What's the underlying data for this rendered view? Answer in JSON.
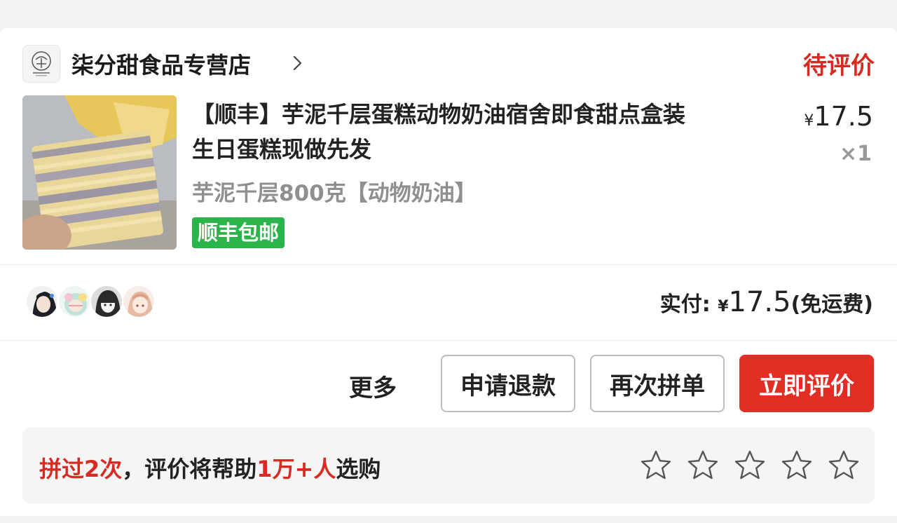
{
  "store": {
    "name": "柒分甜食品专营店",
    "status": "待评价"
  },
  "product": {
    "title_line1": "【顺丰】芋泥千层蛋糕动物奶油宿舍即食甜点盒装",
    "title_line2": "生日蛋糕现做先发",
    "price_symbol": "¥",
    "price": "17.5",
    "quantity": "×1",
    "spec": "芋泥千层800克【动物奶油】",
    "shipping_tag": "顺丰包邮"
  },
  "payment": {
    "label": "实付:",
    "symbol": "¥",
    "amount": "17.5",
    "note": "(免运费)"
  },
  "actions": {
    "more": "更多",
    "refund": "申请退款",
    "rebuy": "再次拼单",
    "review": "立即评价"
  },
  "review_prompt": {
    "prefix": "拼过2次",
    "middle": "，评价将帮助",
    "count": "1万+人",
    "suffix": "选购",
    "star_count": 5
  },
  "colors": {
    "accent_red": "#e12d24",
    "status_red": "#d62b22",
    "tag_green": "#2bb44a"
  }
}
